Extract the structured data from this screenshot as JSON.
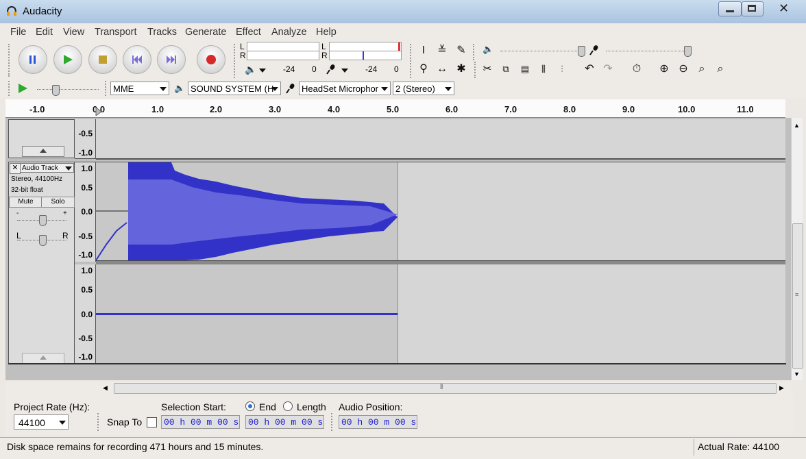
{
  "window": {
    "title": "Audacity"
  },
  "menu": [
    "File",
    "Edit",
    "View",
    "Transport",
    "Tracks",
    "Generate",
    "Effect",
    "Analyze",
    "Help"
  ],
  "meters": {
    "L": "L",
    "R": "R",
    "left_db_a": "-24",
    "left_db_b": "0",
    "right_db_a": "-24",
    "right_db_b": "0"
  },
  "device_toolbar": {
    "host": "MME",
    "output": "SOUND SYSTEM (H",
    "input": "HeadSet Microphor",
    "channels": "2 (Stereo)"
  },
  "ruler": {
    "ticks": [
      "-1.0",
      "0.0",
      "1.0",
      "2.0",
      "3.0",
      "4.0",
      "5.0",
      "6.0",
      "7.0",
      "8.0",
      "9.0",
      "10.0",
      "11.0"
    ]
  },
  "upper_track": {
    "scale": [
      "-0.5",
      "-1.0"
    ]
  },
  "audio_track": {
    "name": "Audio Track",
    "info_line1": "Stereo, 44100Hz",
    "info_line2": "32-bit float",
    "mute": "Mute",
    "solo": "Solo",
    "gain_minus": "-",
    "gain_plus": "+",
    "pan_left": "L",
    "pan_right": "R",
    "scale": [
      "1.0",
      "0.5",
      "0.0",
      "-0.5",
      "-1.0"
    ]
  },
  "selection": {
    "project_rate_label": "Project Rate (Hz):",
    "project_rate": "44100",
    "snap_to": "Snap To",
    "selection_start_label": "Selection Start:",
    "end_label": "End",
    "length_label": "Length",
    "audio_position_label": "Audio Position:",
    "start_time": "00 h 00 m 00 s",
    "end_time": "00 h 00 m 00 s",
    "audio_position": "00 h 00 m 00 s"
  },
  "status": {
    "disk_space": "Disk space remains for recording 471 hours and 15 minutes.",
    "actual_rate": "Actual Rate: 44100"
  },
  "colors": {
    "wave_outer": "#3232c8",
    "wave_inner": "#6464dc",
    "track_bg": "#c8c8c8"
  }
}
